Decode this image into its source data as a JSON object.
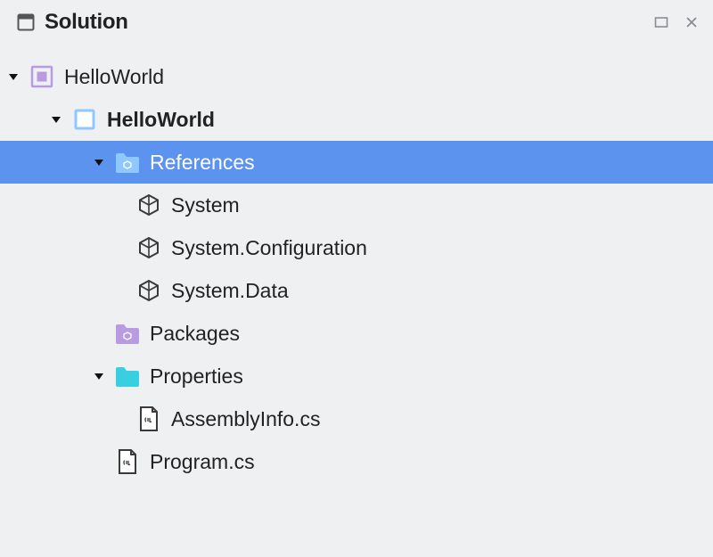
{
  "header": {
    "title": "Solution"
  },
  "tree": {
    "solution": {
      "label": "HelloWorld"
    },
    "project": {
      "label": "HelloWorld"
    },
    "references": {
      "label": "References",
      "items": [
        {
          "label": "System"
        },
        {
          "label": "System.Configuration"
        },
        {
          "label": "System.Data"
        }
      ]
    },
    "packages": {
      "label": "Packages"
    },
    "properties": {
      "label": "Properties",
      "items": [
        {
          "label": "AssemblyInfo.cs"
        }
      ]
    },
    "program": {
      "label": "Program.cs"
    }
  },
  "colors": {
    "selection": "#5c93ef",
    "purple": "#b89be0",
    "cyan": "#38d0e0",
    "blueFolder": "#8fc8ff"
  }
}
